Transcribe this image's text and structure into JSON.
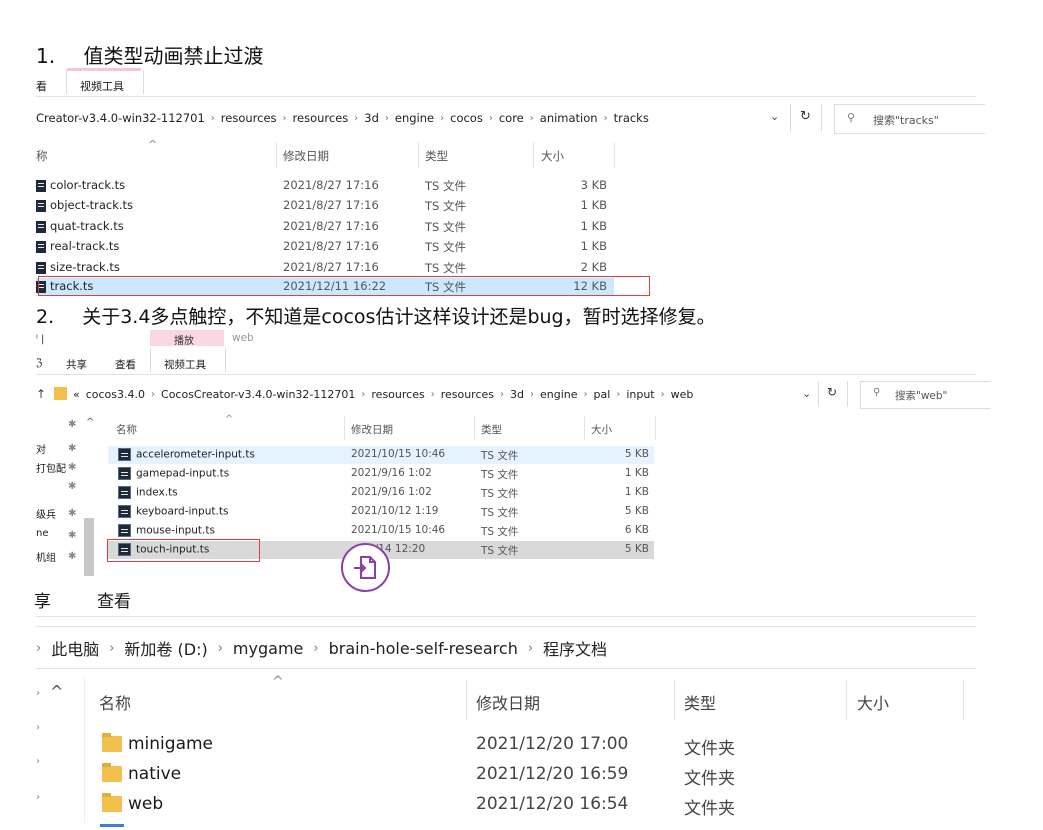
{
  "heading1": {
    "num": "1.",
    "text": "值类型动画禁止过渡"
  },
  "heading2": {
    "num": "2.",
    "text": "关于3.4多点触控，不知道是cocos估计这样设计还是bug，暂时选择修复。"
  },
  "explorer1": {
    "tabs": [
      "查看",
      "视频工具"
    ],
    "tab_partial": "看",
    "breadcrumb": [
      "Creator-v3.4.0-win32-112701",
      "resources",
      "resources",
      "3d",
      "engine",
      "cocos",
      "core",
      "animation",
      "tracks"
    ],
    "search_placeholder": "搜索\"tracks\"",
    "columns": {
      "name": "名称",
      "name_partial": "称",
      "date": "修改日期",
      "type": "类型",
      "size": "大小"
    },
    "files": [
      {
        "name": "color-track.ts",
        "date": "2021/8/27 17:16",
        "type": "TS 文件",
        "size": "3 KB"
      },
      {
        "name": "object-track.ts",
        "date": "2021/8/27 17:16",
        "type": "TS 文件",
        "size": "1 KB"
      },
      {
        "name": "quat-track.ts",
        "date": "2021/8/27 17:16",
        "type": "TS 文件",
        "size": "1 KB"
      },
      {
        "name": "real-track.ts",
        "date": "2021/8/27 17:16",
        "type": "TS 文件",
        "size": "1 KB"
      },
      {
        "name": "size-track.ts",
        "date": "2021/8/27 17:16",
        "type": "TS 文件",
        "size": "2 KB"
      },
      {
        "name": "track.ts",
        "date": "2021/12/11 16:22",
        "type": "TS 文件",
        "size": "12 KB"
      }
    ]
  },
  "explorer2": {
    "context_tab": "播放",
    "context_title": "web",
    "tabs": [
      "共享",
      "查看",
      "视频工具"
    ],
    "breadcrumb": [
      "cocos3.4.0",
      "CocosCreator-v3.4.0-win32-112701",
      "resources",
      "resources",
      "3d",
      "engine",
      "pal",
      "input",
      "web"
    ],
    "breadcrumb_prefix": "«",
    "search_placeholder": "搜索\"web\"",
    "columns": {
      "name": "名称",
      "date": "修改日期",
      "type": "类型",
      "size": "大小"
    },
    "left_nav": [
      "对",
      "打包配",
      "",
      "级兵",
      "ne",
      "机组"
    ],
    "files": [
      {
        "name": "accelerometer-input.ts",
        "date": "2021/10/15 10:46",
        "type": "TS 文件",
        "size": "5 KB"
      },
      {
        "name": "gamepad-input.ts",
        "date": "2021/9/16 1:02",
        "type": "TS 文件",
        "size": "1 KB"
      },
      {
        "name": "index.ts",
        "date": "2021/9/16 1:02",
        "type": "TS 文件",
        "size": "1 KB"
      },
      {
        "name": "keyboard-input.ts",
        "date": "2021/10/12 1:19",
        "type": "TS 文件",
        "size": "5 KB"
      },
      {
        "name": "mouse-input.ts",
        "date": "2021/10/15 10:46",
        "type": "TS 文件",
        "size": "6 KB"
      },
      {
        "name": "touch-input.ts",
        "date": "2/14 12:20",
        "type": "TS 文件",
        "size": "5 KB"
      }
    ]
  },
  "explorer3": {
    "tabs": [
      "享",
      "查看"
    ],
    "breadcrumb": [
      "此电脑",
      "新加卷 (D:)",
      "mygame",
      "brain-hole-self-research",
      "程序文档"
    ],
    "columns": {
      "name": "名称",
      "date": "修改日期",
      "type": "类型",
      "size": "大小"
    },
    "folders": [
      {
        "name": "minigame",
        "date": "2021/12/20 17:00",
        "type": "文件夹"
      },
      {
        "name": "native",
        "date": "2021/12/20 16:59",
        "type": "文件夹"
      },
      {
        "name": "web",
        "date": "2021/12/20 16:54",
        "type": "文件夹"
      }
    ]
  },
  "colors": {
    "selected": "#cce8ff",
    "selected_gray": "#d9d9d9",
    "highlight_box": "#e04040",
    "drag_circle": "#8e3fa7",
    "folder": "#f3c04d"
  }
}
